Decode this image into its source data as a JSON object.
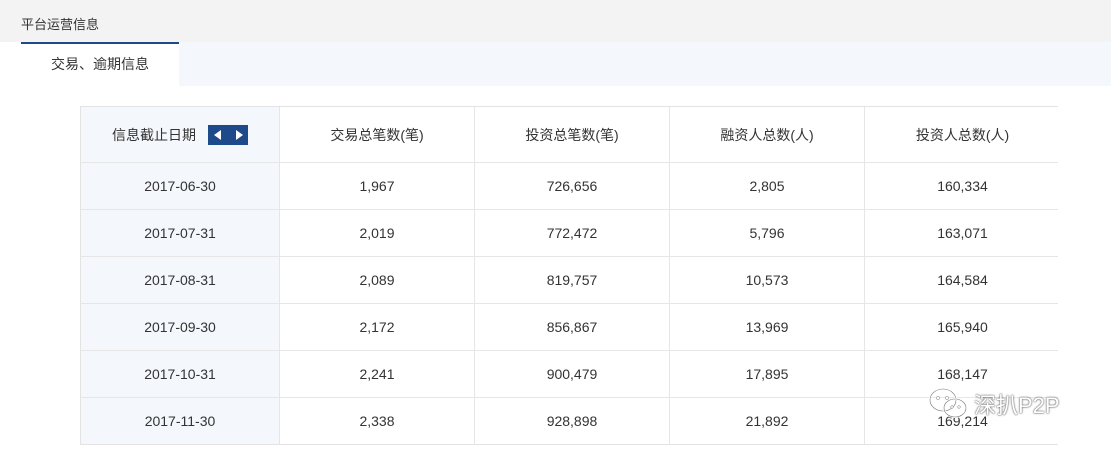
{
  "page": {
    "title": "平台运营信息"
  },
  "tabs": [
    {
      "label": "交易、逾期信息",
      "active": true
    }
  ],
  "table": {
    "headers": [
      "信息截止日期",
      "交易总笔数(笔)",
      "投资总笔数(笔)",
      "融资人总数(人)",
      "投资人总数(人)"
    ],
    "rows": [
      [
        "2017-06-30",
        "1,967",
        "726,656",
        "2,805",
        "160,334"
      ],
      [
        "2017-07-31",
        "2,019",
        "772,472",
        "5,796",
        "163,071"
      ],
      [
        "2017-08-31",
        "2,089",
        "819,757",
        "10,573",
        "164,584"
      ],
      [
        "2017-09-30",
        "2,172",
        "856,867",
        "13,969",
        "165,940"
      ],
      [
        "2017-10-31",
        "2,241",
        "900,479",
        "17,895",
        "168,147"
      ],
      [
        "2017-11-30",
        "2,338",
        "928,898",
        "21,892",
        "169,214"
      ]
    ]
  },
  "watermark": {
    "text": "深扒P2P",
    "icon": "wechat-icon"
  },
  "colors": {
    "accent": "#1e4a8c",
    "header_bg": "#f3f3f3",
    "first_col_bg": "#f4f7fb"
  }
}
